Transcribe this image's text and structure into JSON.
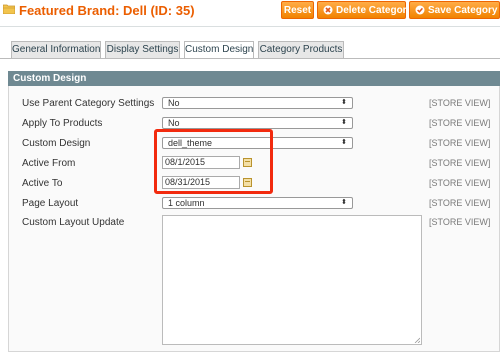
{
  "header": {
    "title": "Featured Brand: Dell (ID: 35)",
    "buttons": {
      "reset": "Reset",
      "delete": "Delete Category",
      "save": "Save Category"
    }
  },
  "tabs": [
    {
      "label": "General Information"
    },
    {
      "label": "Display Settings"
    },
    {
      "label": "Custom Design",
      "active": true
    },
    {
      "label": "Category Products"
    }
  ],
  "section": {
    "title": "Custom Design"
  },
  "fields": {
    "use_parent": {
      "label": "Use Parent Category Settings",
      "value": "No",
      "scope": "[STORE VIEW]"
    },
    "apply_products": {
      "label": "Apply To Products",
      "value": "No",
      "scope": "[STORE VIEW]"
    },
    "custom_design": {
      "label": "Custom Design",
      "value": "dell_theme",
      "scope": "[STORE VIEW]"
    },
    "active_from": {
      "label": "Active From",
      "value": "08/1/2015",
      "scope": "[STORE VIEW]"
    },
    "active_to": {
      "label": "Active To",
      "value": "08/31/2015",
      "scope": "[STORE VIEW]"
    },
    "page_layout": {
      "label": "Page Layout",
      "value": "1 column",
      "scope": "[STORE VIEW]"
    },
    "layout_update": {
      "label": "Custom Layout Update",
      "value": "",
      "scope": "[STORE VIEW]"
    }
  },
  "colors": {
    "title": "#eb5e00",
    "button": "#f18200",
    "section_header": "#6f8992",
    "highlight": "#f22a0e"
  }
}
